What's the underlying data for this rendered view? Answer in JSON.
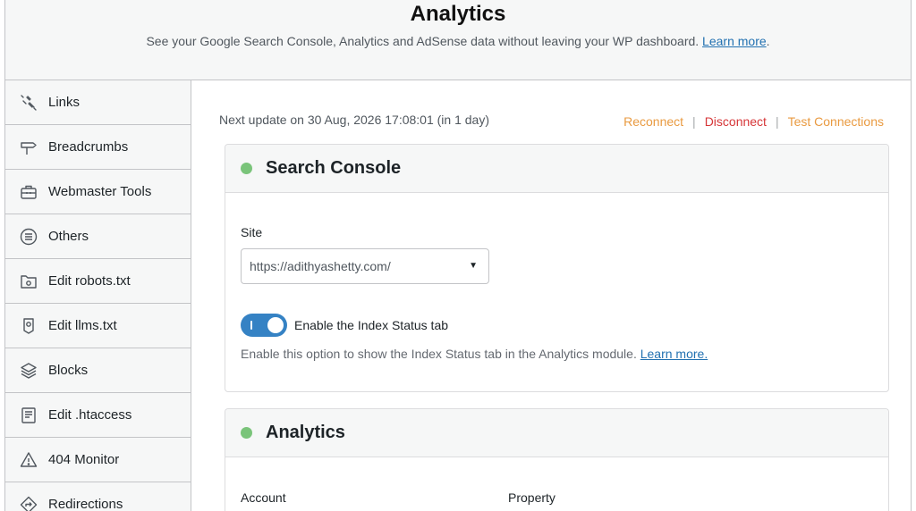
{
  "header": {
    "title": "Analytics",
    "subtitle": "See your Google Search Console, Analytics and AdSense data without leaving your WP dashboard.",
    "learn_more": "Learn more",
    "period": "."
  },
  "sidebar": {
    "items": [
      {
        "label": "Links",
        "icon": "links-icon"
      },
      {
        "label": "Breadcrumbs",
        "icon": "signpost-icon"
      },
      {
        "label": "Webmaster Tools",
        "icon": "toolbox-icon"
      },
      {
        "label": "Others",
        "icon": "list-circle-icon"
      },
      {
        "label": "Edit robots.txt",
        "icon": "robots-file-icon"
      },
      {
        "label": "Edit llms.txt",
        "icon": "llms-file-icon"
      },
      {
        "label": "Blocks",
        "icon": "blocks-icon"
      },
      {
        "label": "Edit .htaccess",
        "icon": "htaccess-file-icon"
      },
      {
        "label": "404 Monitor",
        "icon": "warning-icon"
      },
      {
        "label": "Redirections",
        "icon": "redirect-icon"
      }
    ]
  },
  "main": {
    "next_update": "Next update on 30 Aug, 2026 17:08:01 (in 1 day)",
    "actions": {
      "reconnect": "Reconnect",
      "disconnect": "Disconnect",
      "test": "Test Connections",
      "separator": "|"
    },
    "search_console": {
      "title": "Search Console",
      "site_label": "Site",
      "site_value": "https://adithyashetty.com/",
      "toggle_label": "Enable the Index Status tab",
      "toggle_on": true,
      "description": "Enable this option to show the Index Status tab in the Analytics module.",
      "learn_more": "Learn more."
    },
    "analytics": {
      "title": "Analytics",
      "account_label": "Account",
      "property_label": "Property"
    }
  },
  "colors": {
    "accent": "#2271b1",
    "toggle": "#3582c4",
    "status_dot": "#7ac47a",
    "orange_link": "#e99a40",
    "red_link": "#d63638"
  }
}
